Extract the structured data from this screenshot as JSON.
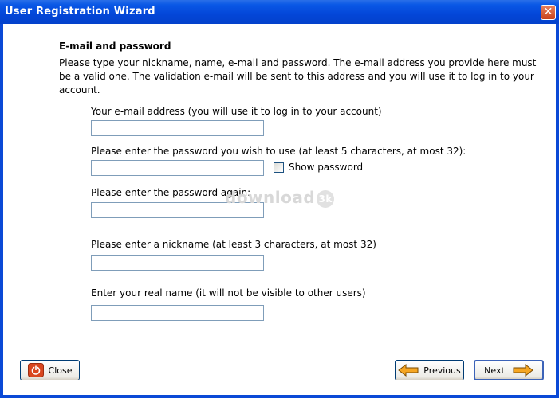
{
  "window": {
    "title": "User Registration Wizard",
    "close_glyph": "✕"
  },
  "header": {
    "title": "E-mail and password",
    "description": "Please type your nickname, name, e-mail and password. The e-mail address you provide here must be a valid one. The validation e-mail will be sent to this address and you will use it to log in to your account."
  },
  "form": {
    "email_label": "Your e-mail address (you will use it to log in to your account)",
    "email_value": "",
    "password_label": "Please enter the password you wish to use (at least 5 characters, at most 32):",
    "password_value": "",
    "show_password_label": "Show password",
    "show_password_checked": false,
    "password_again_label": "Please enter the password again:",
    "password_again_value": "",
    "nickname_label": "Please enter a nickname (at least 3 characters, at most 32)",
    "nickname_value": "",
    "realname_label": "Enter your real name (it will not be visible to other users)",
    "realname_value": ""
  },
  "watermark": {
    "text": "download",
    "badge": "3k"
  },
  "buttons": {
    "close": "Close",
    "previous": "Previous",
    "next": "Next"
  },
  "icons": {
    "close": "power-icon",
    "previous": "arrow-left-icon",
    "next": "arrow-right-icon"
  },
  "colors": {
    "titlebar": "#0a58e6",
    "accent_arrow": "#f5a623",
    "close_icon": "#d9461e"
  }
}
